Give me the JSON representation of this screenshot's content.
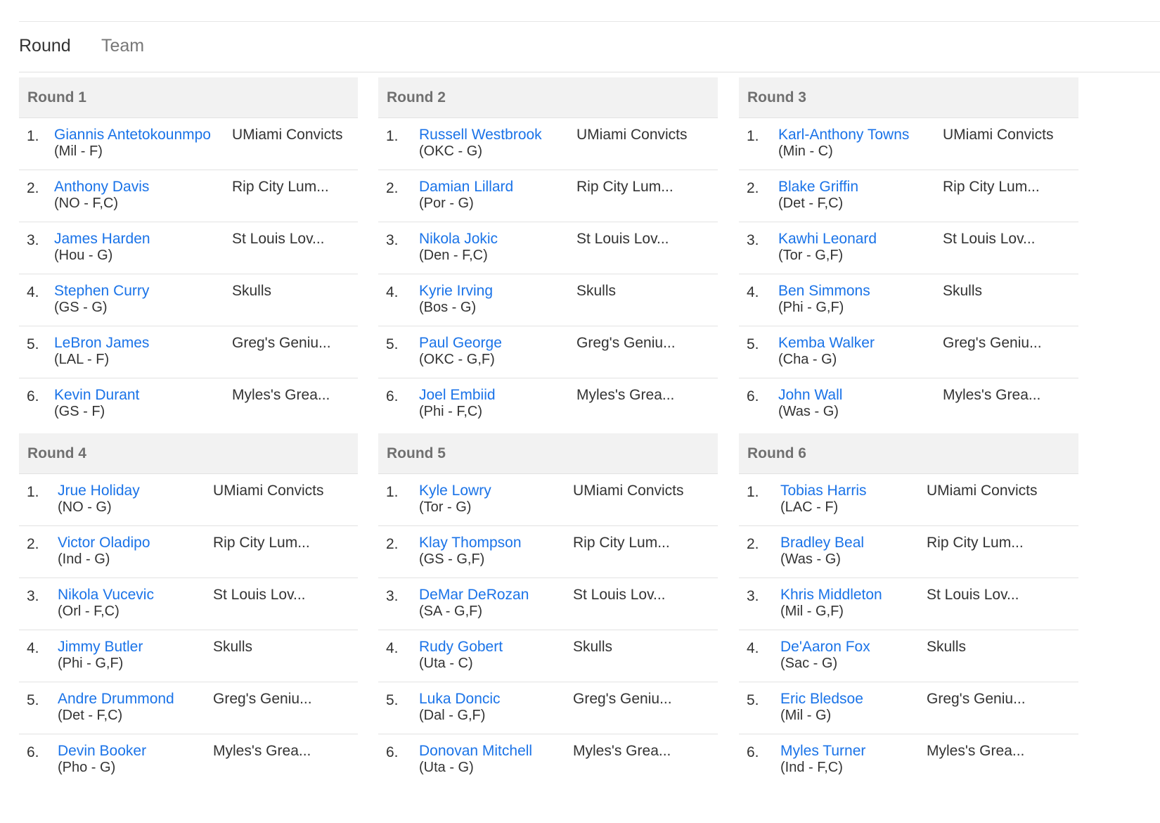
{
  "tabs": [
    {
      "label": "Round",
      "active": true
    },
    {
      "label": "Team",
      "active": false
    }
  ],
  "colors": {
    "link": "#1a73e8",
    "header_bg": "#f2f2f2"
  },
  "rounds": [
    {
      "title": "Round 1",
      "picks": [
        {
          "num": "1.",
          "player": "Giannis Antetokounmpo",
          "info": "(Mil - F)",
          "team": "UMiami Convicts"
        },
        {
          "num": "2.",
          "player": "Anthony Davis",
          "info": "(NO - F,C)",
          "team": "Rip City Lum..."
        },
        {
          "num": "3.",
          "player": "James Harden",
          "info": "(Hou - G)",
          "team": "St Louis Lov..."
        },
        {
          "num": "4.",
          "player": "Stephen Curry",
          "info": "(GS - G)",
          "team": "Skulls"
        },
        {
          "num": "5.",
          "player": "LeBron James",
          "info": "(LAL - F)",
          "team": "Greg's Geniu..."
        },
        {
          "num": "6.",
          "player": "Kevin Durant",
          "info": "(GS - F)",
          "team": "Myles's Grea..."
        }
      ]
    },
    {
      "title": "Round 2",
      "picks": [
        {
          "num": "1.",
          "player": "Russell Westbrook",
          "info": "(OKC - G)",
          "team": "UMiami Convicts"
        },
        {
          "num": "2.",
          "player": "Damian Lillard",
          "info": "(Por - G)",
          "team": "Rip City Lum..."
        },
        {
          "num": "3.",
          "player": "Nikola Jokic",
          "info": "(Den - F,C)",
          "team": "St Louis Lov..."
        },
        {
          "num": "4.",
          "player": "Kyrie Irving",
          "info": "(Bos - G)",
          "team": "Skulls"
        },
        {
          "num": "5.",
          "player": "Paul George",
          "info": "(OKC - G,F)",
          "team": "Greg's Geniu..."
        },
        {
          "num": "6.",
          "player": "Joel Embiid",
          "info": "(Phi - F,C)",
          "team": "Myles's Grea..."
        }
      ]
    },
    {
      "title": "Round 3",
      "picks": [
        {
          "num": "1.",
          "player": "Karl-Anthony Towns",
          "info": "(Min - C)",
          "team": "UMiami Convicts"
        },
        {
          "num": "2.",
          "player": "Blake Griffin",
          "info": "(Det - F,C)",
          "team": "Rip City Lum..."
        },
        {
          "num": "3.",
          "player": "Kawhi Leonard",
          "info": "(Tor - G,F)",
          "team": "St Louis Lov..."
        },
        {
          "num": "4.",
          "player": "Ben Simmons",
          "info": "(Phi - G,F)",
          "team": "Skulls"
        },
        {
          "num": "5.",
          "player": "Kemba Walker",
          "info": "(Cha - G)",
          "team": "Greg's Geniu..."
        },
        {
          "num": "6.",
          "player": "John Wall",
          "info": "(Was - G)",
          "team": "Myles's Grea..."
        }
      ]
    },
    {
      "title": "Round 4",
      "picks": [
        {
          "num": "1.",
          "player": "Jrue Holiday",
          "info": "(NO - G)",
          "team": "UMiami Convicts"
        },
        {
          "num": "2.",
          "player": "Victor Oladipo",
          "info": "(Ind - G)",
          "team": "Rip City Lum..."
        },
        {
          "num": "3.",
          "player": "Nikola Vucevic",
          "info": "(Orl - F,C)",
          "team": "St Louis Lov..."
        },
        {
          "num": "4.",
          "player": "Jimmy Butler",
          "info": "(Phi - G,F)",
          "team": "Skulls"
        },
        {
          "num": "5.",
          "player": "Andre Drummond",
          "info": "(Det - F,C)",
          "team": "Greg's Geniu..."
        },
        {
          "num": "6.",
          "player": "Devin Booker",
          "info": "(Pho - G)",
          "team": "Myles's Grea..."
        }
      ]
    },
    {
      "title": "Round 5",
      "picks": [
        {
          "num": "1.",
          "player": "Kyle Lowry",
          "info": "(Tor - G)",
          "team": "UMiami Convicts"
        },
        {
          "num": "2.",
          "player": "Klay Thompson",
          "info": "(GS - G,F)",
          "team": "Rip City Lum..."
        },
        {
          "num": "3.",
          "player": "DeMar DeRozan",
          "info": "(SA - G,F)",
          "team": "St Louis Lov..."
        },
        {
          "num": "4.",
          "player": "Rudy Gobert",
          "info": "(Uta - C)",
          "team": "Skulls"
        },
        {
          "num": "5.",
          "player": "Luka Doncic",
          "info": "(Dal - G,F)",
          "team": "Greg's Geniu..."
        },
        {
          "num": "6.",
          "player": "Donovan Mitchell",
          "info": "(Uta - G)",
          "team": "Myles's Grea..."
        }
      ]
    },
    {
      "title": "Round 6",
      "picks": [
        {
          "num": "1.",
          "player": "Tobias Harris",
          "info": "(LAC - F)",
          "team": "UMiami Convicts"
        },
        {
          "num": "2.",
          "player": "Bradley Beal",
          "info": "(Was - G)",
          "team": "Rip City Lum..."
        },
        {
          "num": "3.",
          "player": "Khris Middleton",
          "info": "(Mil - G,F)",
          "team": "St Louis Lov..."
        },
        {
          "num": "4.",
          "player": "De'Aaron Fox",
          "info": "(Sac - G)",
          "team": "Skulls"
        },
        {
          "num": "5.",
          "player": "Eric Bledsoe",
          "info": "(Mil - G)",
          "team": "Greg's Geniu..."
        },
        {
          "num": "6.",
          "player": "Myles Turner",
          "info": "(Ind - F,C)",
          "team": "Myles's Grea..."
        }
      ]
    }
  ]
}
